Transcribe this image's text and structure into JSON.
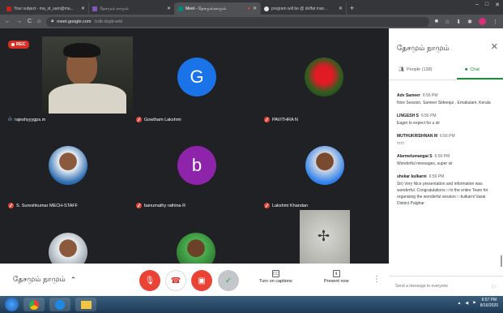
{
  "browser": {
    "tabs": [
      {
        "title": "Your subject - ma_st_sam@ma...",
        "active": false,
        "color": "#c5221f"
      },
      {
        "title": "தேசமும் நாமும்",
        "active": false,
        "color": "#7e57c2"
      },
      {
        "title": "Meet - தேசமும்நாமும்",
        "active": true,
        "color": "#00897b"
      },
      {
        "title": "program will be @ doffat man...",
        "active": false,
        "color": "#e8eaed"
      }
    ],
    "url_host": "meet.google.com",
    "url_path": "/zdb-dcpb-wtd"
  },
  "meet": {
    "rec_label": "REC",
    "meeting_name": "தேசமும் நாமும்",
    "participants": [
      {
        "name": "rajeshyyygps.m",
        "kind": "video",
        "muted": false
      },
      {
        "name": "Gowtham Lakshmi",
        "kind": "letter",
        "letter": "G",
        "color": "#1a73e8",
        "muted": true
      },
      {
        "name": "PAVITHRA N",
        "kind": "rose",
        "muted": true
      },
      {
        "name": "S. Sureshkumar MECH-STAFF",
        "kind": "photo",
        "muted": true
      },
      {
        "name": "banumathy rathina R",
        "kind": "letter",
        "letter": "b",
        "color": "#8e24aa",
        "muted": true
      },
      {
        "name": "Lakshmi Khandan",
        "kind": "photo",
        "muted": true
      },
      {
        "name": "",
        "kind": "photo",
        "muted": false
      },
      {
        "name": "",
        "kind": "photo",
        "muted": false
      },
      {
        "name": "",
        "kind": "fan",
        "muted": false
      }
    ],
    "controls": {
      "captions_label": "Turn on captions",
      "present_label": "Present now",
      "cc_glyph": "CC",
      "present_glyph": "⬆"
    }
  },
  "panel": {
    "title": "தேசமும் நாமும்",
    "people_label": "People (138)",
    "chat_label": "Chat",
    "messages": [
      {
        "sender": "Adv Sameer",
        "time": "6:56 PM",
        "text": "Nice Session, Sameer Sideequi , Ernakulam, Kerala"
      },
      {
        "sender": "LINGESH S",
        "time": "6:56 PM",
        "text": "Eager to expect for u sir"
      },
      {
        "sender": "MUTHUKRISHNAN M",
        "time": "6:56 PM",
        "text": "□□□"
      },
      {
        "sender": "Alarmelumangai S",
        "time": "6:56 PM",
        "text": "Wonderful  messages, super sir"
      },
      {
        "sender": "shekar kulkarni",
        "time": "6:56 PM",
        "text": "Sir) Very Nice presentation and information was wonderful. Congratulations □ to the entire Team for organising the wonderful session □ kulkarni Vasai District Palghar"
      }
    ],
    "send_placeholder": "Send a message to everyone"
  },
  "taskbar": {
    "time": "6:57 PM",
    "date": "8/16/2020"
  }
}
